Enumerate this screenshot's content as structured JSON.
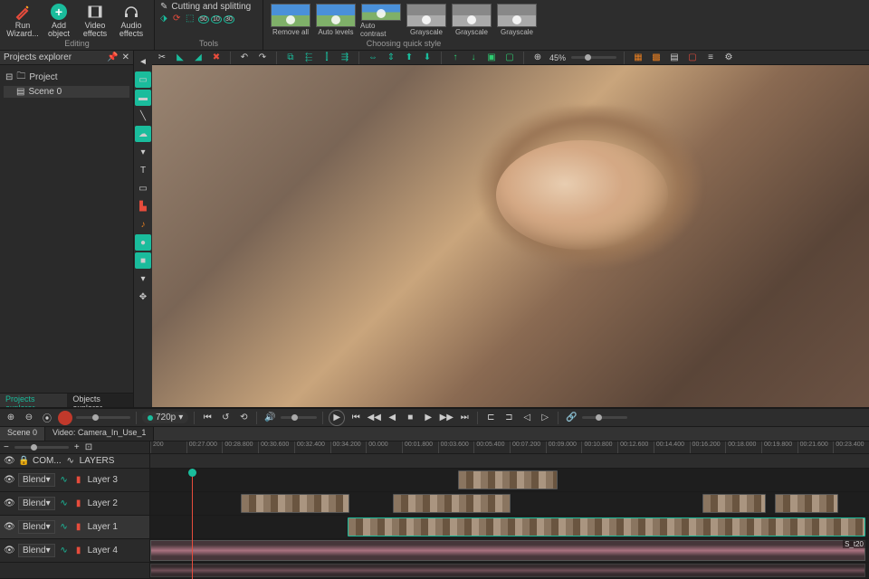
{
  "ribbon": {
    "run_wizard": "Run\nWizard...",
    "add_object": "Add\nobject",
    "video_effects": "Video\neffects",
    "audio_effects": "Audio\neffects",
    "editing_label": "Editing",
    "cutting_splitting": "Cutting and splitting",
    "tools_label": "Tools",
    "styles": [
      "Remove all",
      "Auto levels",
      "Auto contrast",
      "Grayscale",
      "Grayscale",
      "Grayscale"
    ],
    "quick_style_label": "Choosing quick style"
  },
  "sidebar": {
    "title": "Projects explorer",
    "project": "Project",
    "scene": "Scene 0",
    "tabs": [
      "Projects explorer",
      "Objects explorer"
    ]
  },
  "preview_bar": {
    "zoom": "45%"
  },
  "transport": {
    "resolution": "720p"
  },
  "timeline": {
    "scene_tab": "Scene 0",
    "video_tab": "Video: Camera_In_Use_1",
    "ticks": [
      "200",
      "00:27.000",
      "00:28.800",
      "00:30.600",
      "00:32.400",
      "00:34.200",
      "00.000",
      "00:01.800",
      "00:03.600",
      "00:05.400",
      "00:07.200",
      "00:09.000",
      "00:10.800",
      "00:12.600",
      "00:14.400",
      "00:16.200",
      "00:18.000",
      "00:19.800",
      "00:21.600",
      "00:23.400"
    ],
    "header_cols": [
      "COM...",
      "LAYERS"
    ],
    "tracks": [
      {
        "name": "Layer 3",
        "blend": "Blend"
      },
      {
        "name": "Layer 2",
        "blend": "Blend"
      },
      {
        "name": "Layer 1",
        "blend": "Blend"
      },
      {
        "name": "Layer 4",
        "blend": "Blend"
      }
    ],
    "end_label": "S_t20"
  }
}
